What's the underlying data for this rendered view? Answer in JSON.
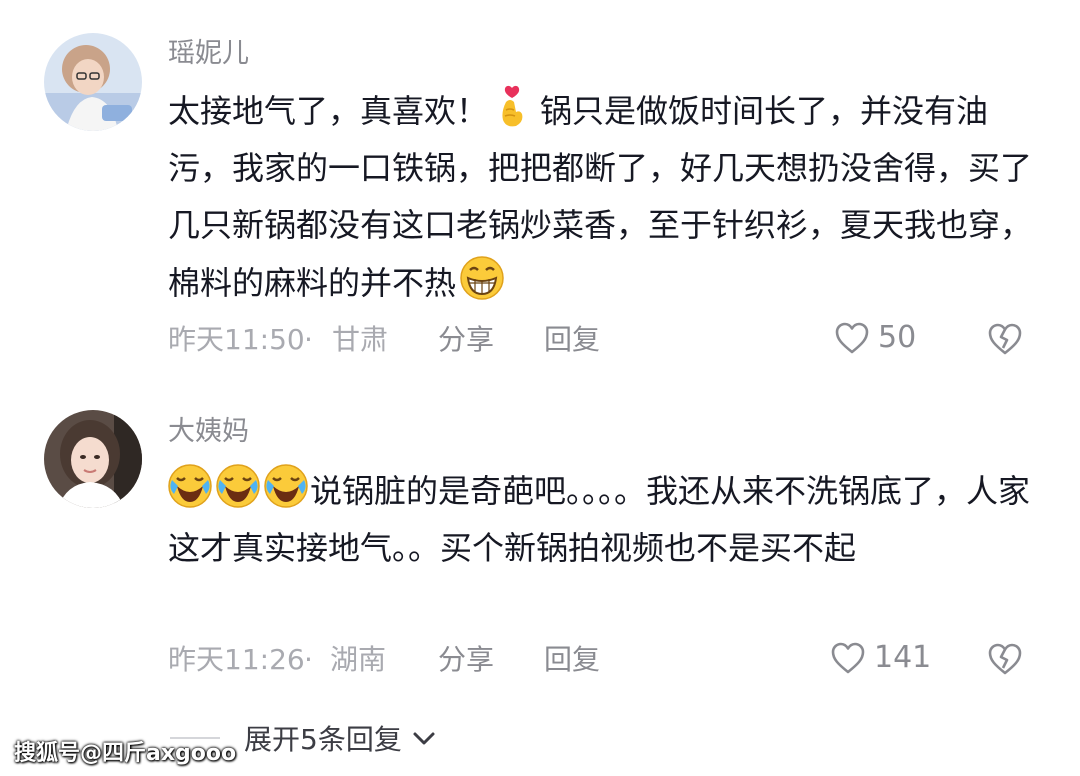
{
  "comments": [
    {
      "username": "瑶妮儿",
      "text_a": "太接地气了，真喜欢！",
      "text_b": "锅只是做饭时间长了，并没有油污，我家的一口铁锅，把把都断了，好几天想扔没舍得，买了几只新锅都没有这口老锅炒菜香，至于针织衫，夏天我也穿，棉料的麻料的并不热",
      "emoji_a": "finger-heart-emoji",
      "emoji_b": "grinning-face-emoji",
      "time": "昨天11:50",
      "dot": "·",
      "location": "甘肃",
      "share_label": "分享",
      "reply_label": "回复",
      "likes": "50"
    },
    {
      "username": "大姨妈",
      "emoji_a": "rolling-laughing-emoji",
      "text_a": "说锅脏的是奇葩吧。。。。我还从来不洗锅底了，人家这才真实接地气。。买个新锅拍视频也不是买不起",
      "time": "昨天11:26",
      "dot": "·",
      "location": "湖南",
      "share_label": "分享",
      "reply_label": "回复",
      "likes": "141"
    }
  ],
  "expand_label": "展开5条回复",
  "watermark": "搜狐号@四斤axgooo",
  "icons": {
    "like": "heart-outline-icon",
    "dislike": "broken-heart-icon",
    "expand": "chevron-down-icon"
  },
  "colors": {
    "text": "#161823",
    "secondary": "#8a8b91",
    "muted": "#a9aab0"
  }
}
